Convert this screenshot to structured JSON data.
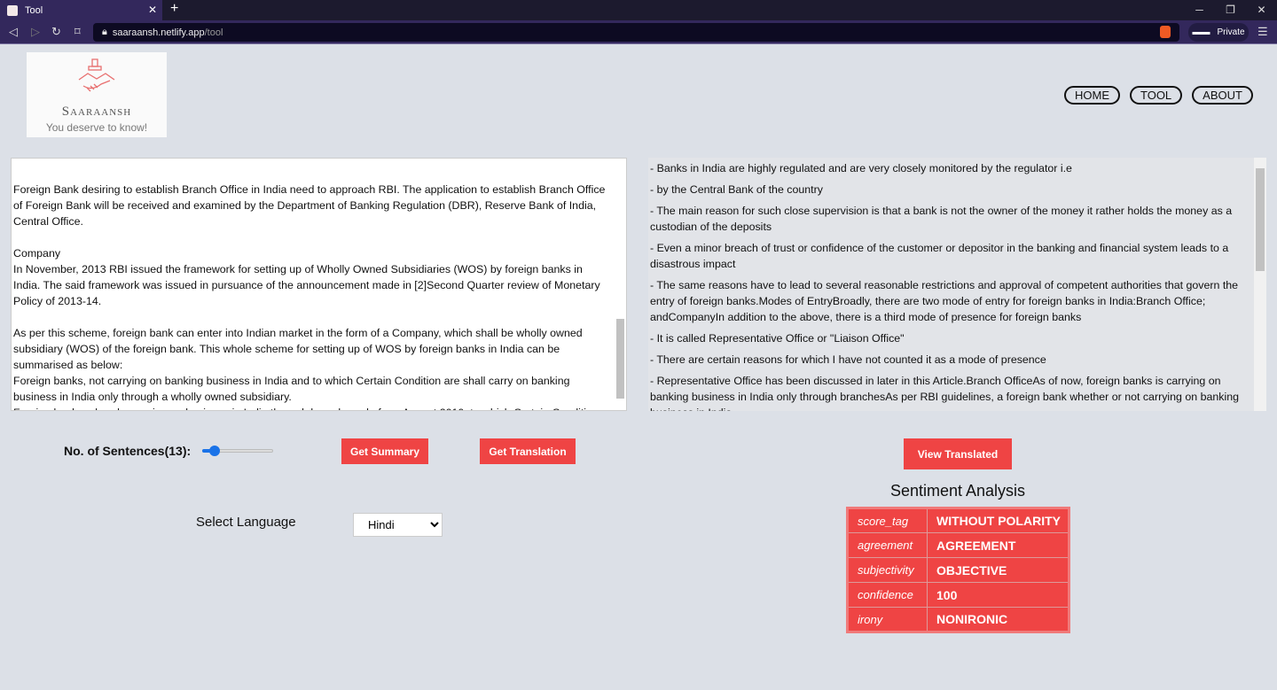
{
  "browser": {
    "tab_title": "Tool",
    "url_host": "saaraansh.netlify.app",
    "url_path": "/tool",
    "private_label": "Private"
  },
  "logo": {
    "name": "Saaraansh",
    "tagline": "You deserve to know!"
  },
  "nav": [
    {
      "label": "HOME"
    },
    {
      "label": "TOOL"
    },
    {
      "label": "ABOUT"
    }
  ],
  "input_text": "\nForeign Bank desiring to establish Branch Office in India need to approach RBI. The application to establish Branch Office of Foreign Bank will be received and examined by the Department of Banking Regulation (DBR), Reserve Bank of India, Central Office.\n\nCompany\nIn November, 2013 RBI issued the framework for setting up of Wholly Owned Subsidiaries (WOS) by foreign banks in India. The said framework was issued in pursuance of the announcement made in [2]Second Quarter review of Monetary Policy of 2013-14.\n\nAs per this scheme, foreign bank can enter into Indian market in the form of a Company, which shall be wholly owned subsidiary (WOS) of the foreign bank. This whole scheme for setting up of WOS by foreign banks in India can be summarised as below:\nForeign banks, not carrying on banking business in India and to which Certain Condition are shall carry on banking business in India only through a wholly owned subsidiary.\nForeign banks, already carrying on business in India through branch mode from August 2010, to which Certain Conditions gets applicable at later stage, would have would convert their branches to Company.\nForeign banks, already carrying on business in India through branch mode before August 2010 shall have the option to carry on business in India through Company mode.",
  "summary": [
    "- Banks in India are highly regulated and are very closely monitored by the regulator i.e",
    "- by the Central Bank of the country",
    "- The main reason for such close supervision is that a bank is not the owner of the money it rather holds the money as a custodian of the deposits",
    "- Even a minor breach of trust or confidence of the customer or depositor in the banking and financial system leads to a disastrous impact",
    "- The same reasons have to lead to several reasonable restrictions and approval of competent authorities that govern the entry of foreign banks.Modes of EntryBroadly, there are two mode of entry for foreign banks in India:Branch Office; andCompanyIn addition to the above, there is a third mode of presence for foreign banks",
    "- It is called Representative Office or \"Liaison Office\"",
    "- There are certain reasons for which I have not counted it as a mode of presence",
    "- Representative Office has been discussed in later in this Article.Branch OfficeAs of now, foreign banks is carrying on banking business in India only through branchesAs per RBI guidelines, a foreign bank whether or not carrying on banking business in India"
  ],
  "controls": {
    "sentences_label": "No. of Sentences(13):",
    "sentences_value": 13,
    "sentences_fraction": 0.12,
    "summary_button": "Get Summary",
    "translation_button": "Get Translation",
    "view_translated_button": "View Translated",
    "language_label": "Select Language",
    "language_selected": "Hindi"
  },
  "sentiment": {
    "title": "Sentiment Analysis",
    "rows": [
      {
        "key": "score_tag",
        "value": "WITHOUT POLARITY"
      },
      {
        "key": "agreement",
        "value": "AGREEMENT"
      },
      {
        "key": "subjectivity",
        "value": "OBJECTIVE"
      },
      {
        "key": "confidence",
        "value": "100"
      },
      {
        "key": "irony",
        "value": "NONIRONIC"
      }
    ]
  },
  "colors": {
    "accent": "#ef4444",
    "background": "#dce0e7",
    "browser": "#33285c"
  }
}
